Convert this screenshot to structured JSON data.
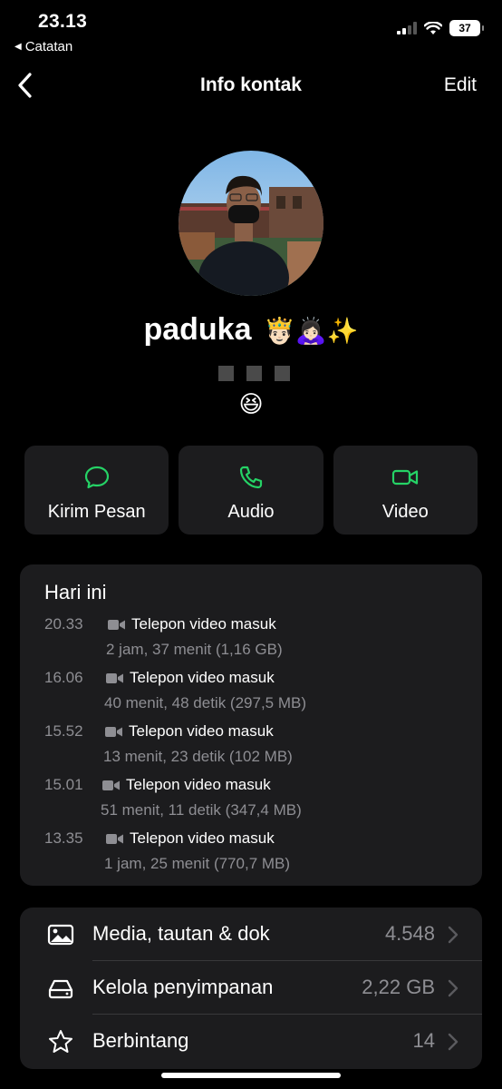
{
  "status_bar": {
    "time": "23.13",
    "back_app": "Catatan",
    "battery": "37"
  },
  "nav": {
    "title": "Info kontak",
    "edit": "Edit"
  },
  "profile": {
    "name": "paduka",
    "name_emoji": "🤴🏻🙇🏻‍♀️✨",
    "status_emoji": "😆"
  },
  "actions": [
    {
      "label": "Kirim Pesan",
      "icon": "message-icon"
    },
    {
      "label": "Audio",
      "icon": "phone-icon"
    },
    {
      "label": "Video",
      "icon": "video-icon"
    }
  ],
  "calls": {
    "title": "Hari ini",
    "items": [
      {
        "time": "20.33",
        "type": "Telepon video masuk",
        "detail": "2 jam, 37 menit (1,16 GB)"
      },
      {
        "time": "16.06",
        "type": "Telepon video masuk",
        "detail": "40 menit, 48 detik (297,5 MB)"
      },
      {
        "time": "15.52",
        "type": "Telepon video masuk",
        "detail": "13 menit, 23 detik (102 MB)"
      },
      {
        "time": "15.01",
        "type": "Telepon video masuk",
        "detail": "51 menit, 11 detik (347,4 MB)"
      },
      {
        "time": "13.35",
        "type": "Telepon video masuk",
        "detail": "1 jam, 25 menit (770,7 MB)"
      }
    ]
  },
  "menu": [
    {
      "label": "Media, tautan & dok",
      "value": "4.548",
      "icon": "photo-icon"
    },
    {
      "label": "Kelola penyimpanan",
      "value": "2,22 GB",
      "icon": "storage-icon"
    },
    {
      "label": "Berbintang",
      "value": "14",
      "icon": "star-icon"
    }
  ],
  "colors": {
    "accent_green": "#25d366",
    "card_bg": "#1c1c1e",
    "secondary_text": "#8e8e93"
  }
}
